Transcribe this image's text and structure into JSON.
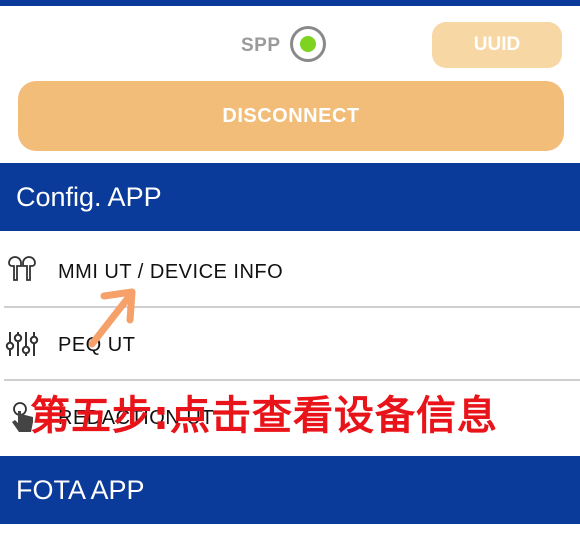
{
  "connection": {
    "spp_label": "SPP",
    "spp_selected": true,
    "uuid_label": "UUID"
  },
  "disconnect_label": "DISCONNECT",
  "config_section": {
    "title": "Config. APP",
    "items": [
      {
        "label": "MMI UT / DEVICE INFO",
        "icon": "earbuds-icon"
      },
      {
        "label": "PEQ UT",
        "icon": "equalizer-sliders-icon"
      },
      {
        "label": "REDACTION UT",
        "icon": "touch-hand-icon"
      }
    ]
  },
  "fota_section": {
    "title": "FOTA APP"
  },
  "annotation": {
    "text": "第五步:点击查看设备信息",
    "color": "#e8141a"
  },
  "colors": {
    "header_blue": "#0a3a9a",
    "button_orange": "#f1bd78",
    "uuid_orange": "#f7d7a4",
    "radio_green": "#7ed321"
  }
}
